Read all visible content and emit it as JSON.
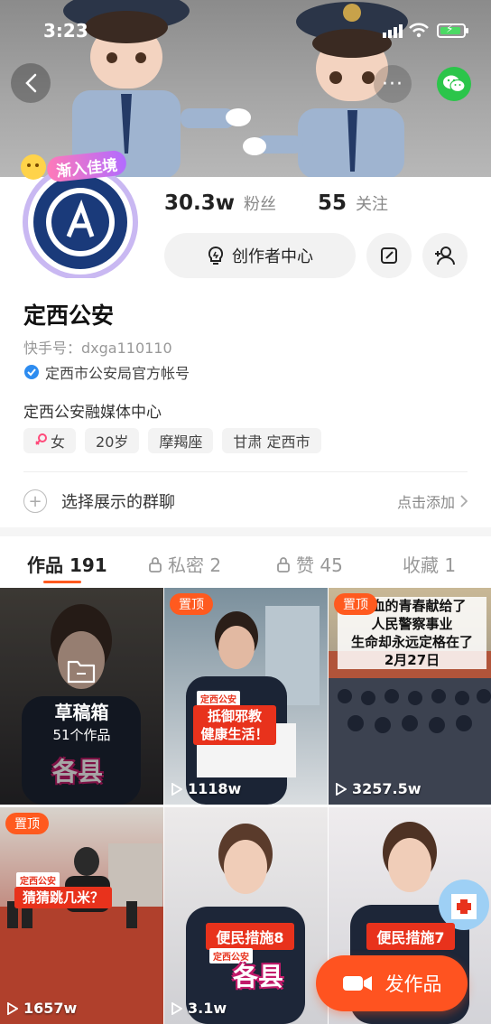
{
  "status": {
    "time": "3:23"
  },
  "profile": {
    "badge_text": "渐入佳境",
    "followers_count": "30.3w",
    "followers_label": "粉丝",
    "following_count": "55",
    "following_label": "关注",
    "creator_center_label": "创作者中心",
    "name": "定西公安",
    "kwai_id": "快手号：dxga110110",
    "verified_text": "定西市公安局官方帐号",
    "bio": "定西公安融媒体中心",
    "tags": [
      "女",
      "20岁",
      "摩羯座",
      "甘肃 定西市"
    ],
    "group_chat_title": "选择展示的群聊",
    "group_chat_action": "点击添加"
  },
  "tabs": [
    {
      "label": "作品 191",
      "locked": false,
      "active": true
    },
    {
      "label": "私密 2",
      "locked": true,
      "active": false
    },
    {
      "label": "赞 45",
      "locked": true,
      "active": false
    },
    {
      "label": "收藏 1",
      "locked": false,
      "active": false
    }
  ],
  "grid": {
    "draft": {
      "title": "草稿箱",
      "count": "51个作品"
    },
    "items": [
      {
        "pinned_label": "置顶",
        "views": "1118w",
        "caption_small": "定西公安",
        "caption": "抵御邪教\n健康生活！"
      },
      {
        "pinned_label": "置顶",
        "views": "3257.5w",
        "headline": "热血的青春献给了\n人民警察事业\n生命却永远定格在了\n2月27日"
      },
      {
        "pinned_label": "置顶",
        "views": "1657w",
        "caption_small": "定西公安",
        "caption": "猜猜跳几米？"
      },
      {
        "views": "3.1w",
        "caption_small": "定西公安",
        "caption": "便民措施8",
        "overlay_text": "各县"
      },
      {
        "caption": "便民措施7"
      }
    ]
  },
  "fab_label": "发作品",
  "colors": {
    "accent": "#ff5a1f",
    "wechat": "#2bc54a",
    "caption_red": "#e8321c"
  }
}
